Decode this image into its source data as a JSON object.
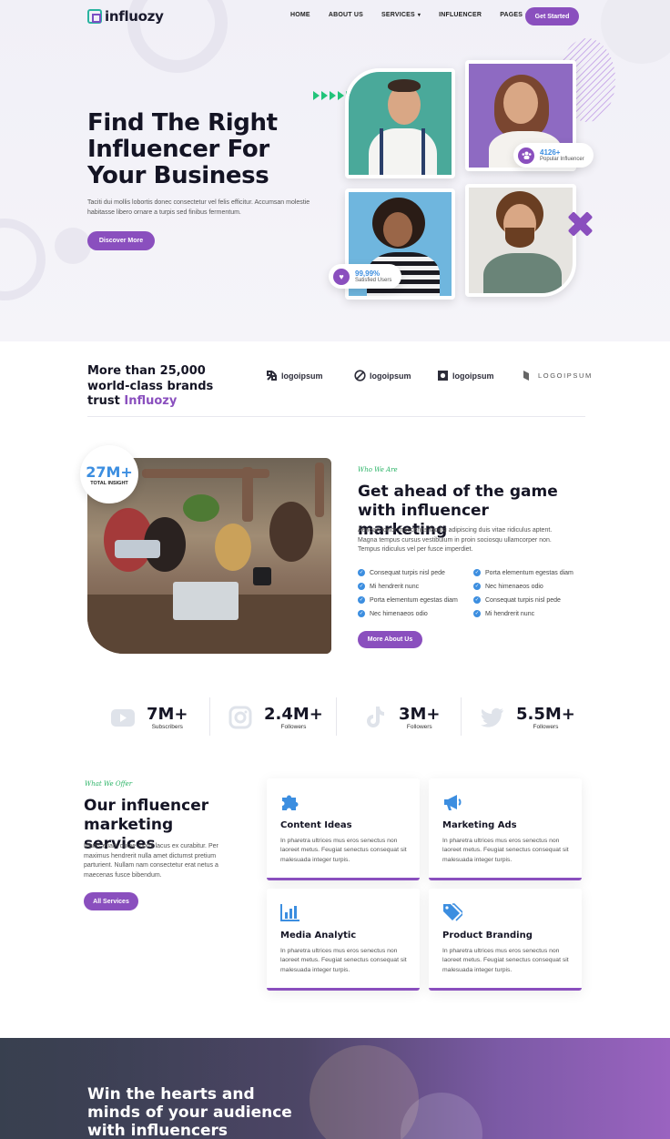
{
  "brand": {
    "name": "influozy"
  },
  "nav": {
    "items": [
      {
        "label": "HOME",
        "dropdown": false
      },
      {
        "label": "ABOUT US",
        "dropdown": false
      },
      {
        "label": "SERVICES",
        "dropdown": true
      },
      {
        "label": "INFLUENCER",
        "dropdown": false
      },
      {
        "label": "PAGES",
        "dropdown": true
      }
    ],
    "cta": "Get Started"
  },
  "hero": {
    "title": "Find The Right Influencer For Your Business",
    "subtitle": "Taciti dui mollis lobortis donec consectetur vel felis efficitur. Accumsan molestie habitasse libero ornare a turpis sed finibus fermentum.",
    "button": "Discover More",
    "stat_popular": {
      "value": "4126+",
      "label": "Popular Influencer"
    },
    "stat_satisfied": {
      "value": "99,99%",
      "label": "Satisfied Users"
    }
  },
  "brands": {
    "title_prefix": "More than 25,000 world-class brands trust",
    "title_accent": "Influozy",
    "logos": [
      "logoipsum",
      "logoipsum",
      "logoipsum",
      "LOGOIPSUM"
    ]
  },
  "about": {
    "badge_value": "27M+",
    "badge_label": "TOTAL INSIGHT",
    "eyebrow": "Who We Are",
    "title": "Get ahead of the game with influencer marketing",
    "text": "Aenean tortor maecenas facilisi adipiscing duis vitae ridiculus aptent. Magna tempus cursus vestibulum in proin sociosqu ullamcorper non. Tempus ridiculus vel per fusce imperdiet.",
    "checklist": [
      "Consequat turpis nisl pede",
      "Porta elementum egestas diam",
      "Mi hendrerit nunc",
      "Nec himenaeos odio",
      "Porta elementum egestas diam",
      "Consequat turpis nisl pede",
      "Nec himenaeos odio",
      "Mi hendrerit nunc"
    ],
    "button": "More About Us"
  },
  "social": [
    {
      "icon": "youtube-icon",
      "value": "7M+",
      "label": "Subscribers"
    },
    {
      "icon": "instagram-icon",
      "value": "2.4M+",
      "label": "Followers"
    },
    {
      "icon": "tiktok-icon",
      "value": "3M+",
      "label": "Followers"
    },
    {
      "icon": "twitter-icon",
      "value": "5.5M+",
      "label": "Followers"
    }
  ],
  "services": {
    "eyebrow": "What We Offer",
    "title": "Our influencer marketing services",
    "text": "Mattis etiam curae morbi lacus ex curabitur. Per maximus hendrerit nulla amet dictumst pretium parturient. Nullam nam consectetur erat netus a maecenas fusce bibendum.",
    "button": "All Services",
    "cards": [
      {
        "icon": "puzzle-icon",
        "title": "Content Ideas",
        "text": "In pharetra ultrices mus eros senectus non laoreet metus. Feugiat senectus consequat sit malesuada integer turpis."
      },
      {
        "icon": "megaphone-icon",
        "title": "Marketing Ads",
        "text": "In pharetra ultrices mus eros senectus non laoreet metus. Feugiat senectus consequat sit malesuada integer turpis."
      },
      {
        "icon": "bar-chart-icon",
        "title": "Media Analytic",
        "text": "In pharetra ultrices mus eros senectus non laoreet metus. Feugiat senectus consequat sit malesuada integer turpis."
      },
      {
        "icon": "tags-icon",
        "title": "Product Branding",
        "text": "In pharetra ultrices mus eros senectus non laoreet metus. Feugiat senectus consequat sit malesuada integer turpis."
      }
    ]
  },
  "banner": {
    "title": "Win the hearts and minds of your audience with influencers"
  },
  "colors": {
    "accent": "#8a4fbe",
    "blue": "#3c8ee0",
    "green": "#2ab366",
    "dark": "#151525"
  }
}
